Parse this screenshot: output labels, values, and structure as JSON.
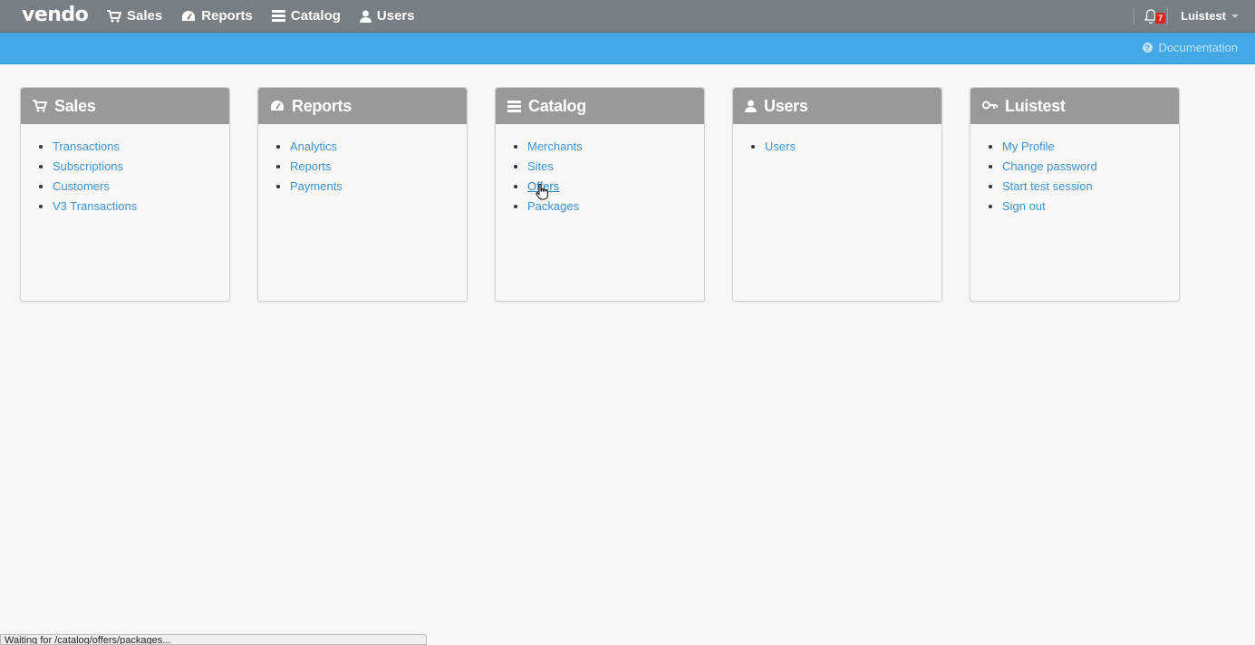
{
  "app": {
    "logo": "vendo"
  },
  "nav": {
    "items": [
      {
        "label": "Sales",
        "icon": "cart-icon"
      },
      {
        "label": "Reports",
        "icon": "dashboard-icon"
      },
      {
        "label": "Catalog",
        "icon": "list-icon"
      },
      {
        "label": "Users",
        "icon": "user-icon"
      }
    ]
  },
  "header": {
    "notifications": {
      "icon": "bell-icon",
      "count": "7"
    },
    "user": "Luistest",
    "documentation": "Documentation"
  },
  "cards": [
    {
      "title": "Sales",
      "icon": "cart-icon",
      "links": [
        "Transactions",
        "Subscriptions",
        "Customers",
        "V3 Transactions"
      ]
    },
    {
      "title": "Reports",
      "icon": "dashboard-icon",
      "links": [
        "Analytics",
        "Reports",
        "Payments"
      ]
    },
    {
      "title": "Catalog",
      "icon": "list-icon",
      "links": [
        "Merchants",
        "Sites",
        "Offers",
        "Packages"
      ]
    },
    {
      "title": "Users",
      "icon": "user-icon",
      "links": [
        "Users"
      ]
    },
    {
      "title": "Luistest",
      "icon": "key-icon",
      "links": [
        "My Profile",
        "Change password",
        "Start test session",
        "Sign out"
      ]
    }
  ],
  "status": {
    "text": "Waiting for /catalog/offers/packages..."
  },
  "colors": {
    "topbar": "#787f84",
    "subbar": "#42a9e6",
    "card_header": "#999999",
    "link": "#3d93d6",
    "badge": "#d9261c"
  }
}
